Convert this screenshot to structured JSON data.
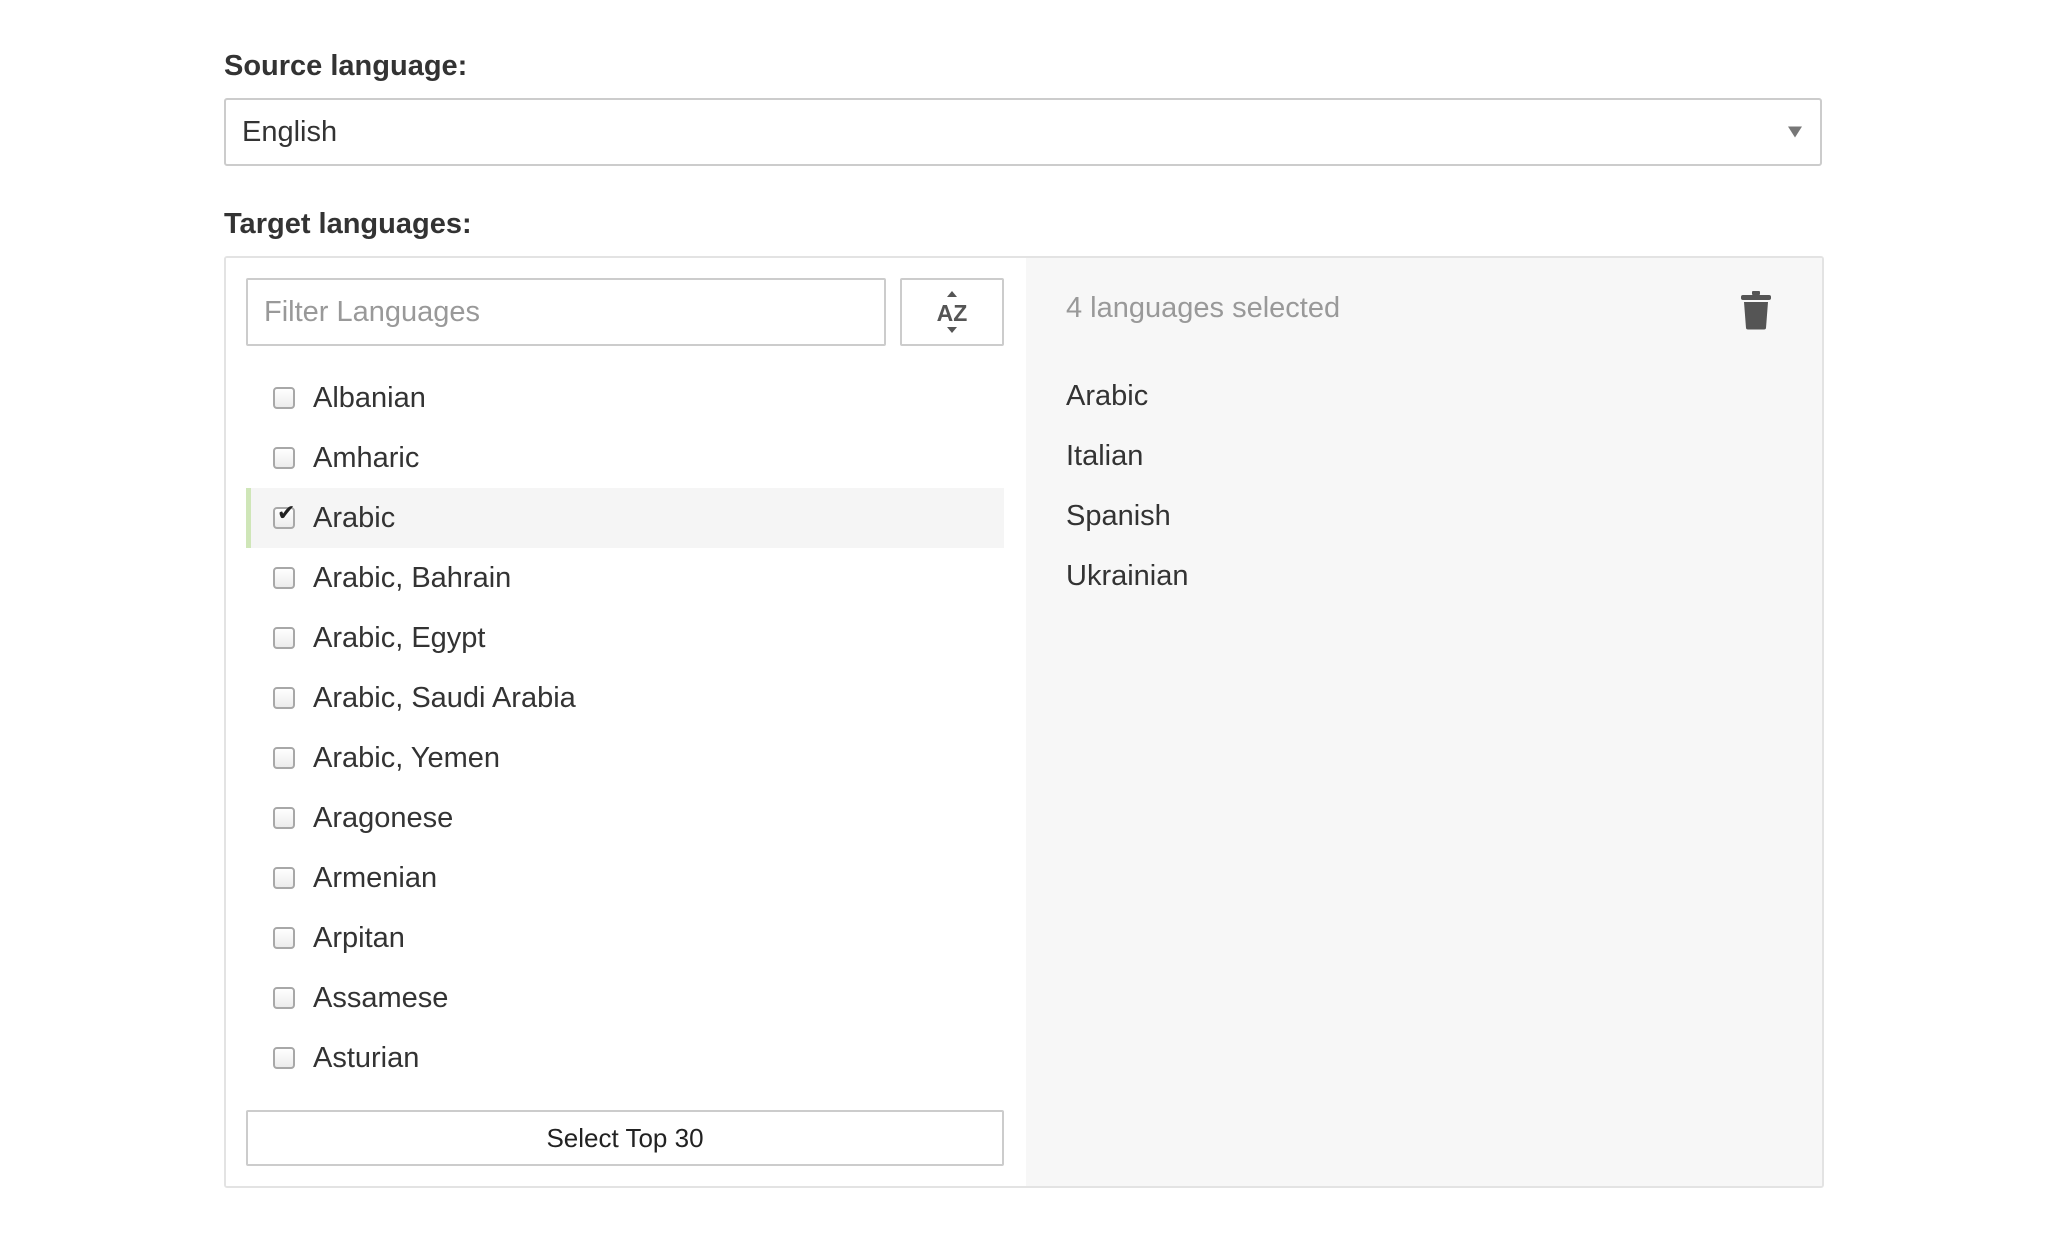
{
  "source": {
    "label": "Source language:",
    "selected_value": "English"
  },
  "target": {
    "label": "Target languages:",
    "filter_placeholder": "Filter Languages",
    "sort_icon": "az-sort-icon",
    "languages": [
      {
        "name": "Albanian",
        "checked": false
      },
      {
        "name": "Amharic",
        "checked": false
      },
      {
        "name": "Arabic",
        "checked": true
      },
      {
        "name": "Arabic, Bahrain",
        "checked": false
      },
      {
        "name": "Arabic, Egypt",
        "checked": false
      },
      {
        "name": "Arabic, Saudi Arabia",
        "checked": false
      },
      {
        "name": "Arabic, Yemen",
        "checked": false
      },
      {
        "name": "Aragonese",
        "checked": false
      },
      {
        "name": "Armenian",
        "checked": false
      },
      {
        "name": "Arpitan",
        "checked": false
      },
      {
        "name": "Assamese",
        "checked": false
      },
      {
        "name": "Asturian",
        "checked": false
      }
    ],
    "select_top_label": "Select Top 30",
    "selected_count_text": "4 languages selected",
    "clear_icon": "trash-icon",
    "selected_languages": [
      "Arabic",
      "Italian",
      "Spanish",
      "Ukrainian"
    ]
  },
  "colors": {
    "highlight_bar": "#cfe6b8",
    "selected_row_bg": "#f5f5f5",
    "right_pane_bg": "#f7f7f7",
    "muted_text": "#999999"
  }
}
